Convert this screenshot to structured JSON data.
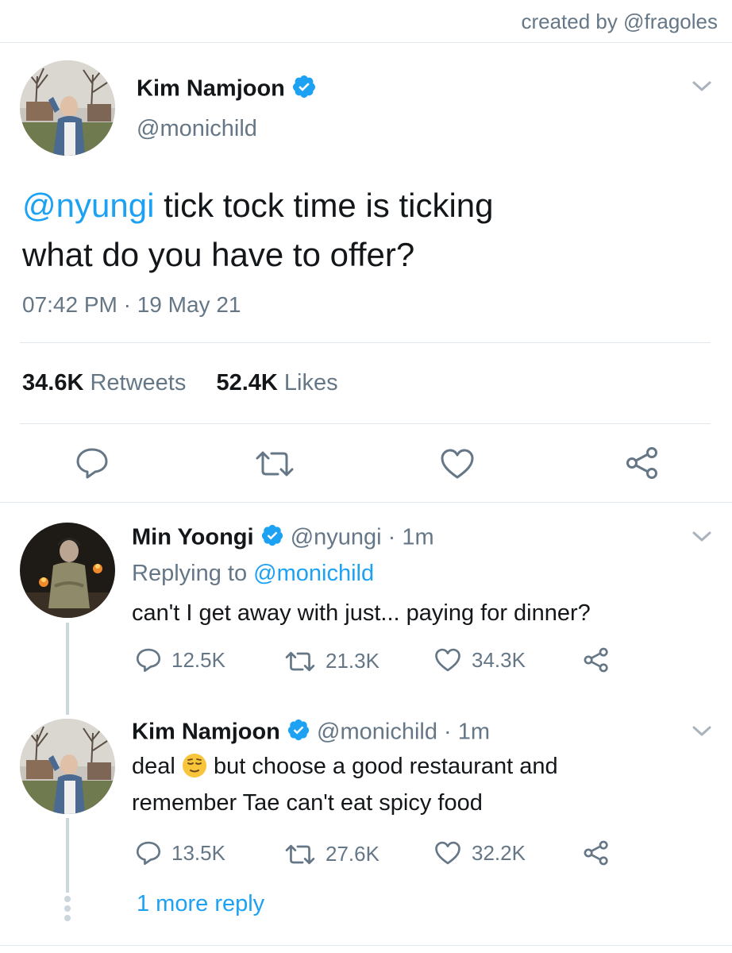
{
  "credit": "created by @fragoles",
  "main_tweet": {
    "name": "Kim Namjoon",
    "handle": "@monichild",
    "mention": "@nyungi",
    "text_line1": " tick tock time is ticking",
    "text_line2": "what do you have to offer?",
    "timestamp": "07:42 PM · 19 May 21",
    "retweets_count": "34.6K",
    "retweets_label": "Retweets",
    "likes_count": "52.4K",
    "likes_label": "Likes",
    "actions": [
      "reply-icon",
      "retweet-icon",
      "like-icon",
      "share-icon"
    ]
  },
  "reply1": {
    "name": "Min Yoongi",
    "handle": "@nyungi",
    "time": "· 1m",
    "replying_prefix": "Replying to ",
    "replying_to": "@monichild",
    "text": "can't I get away with just... paying for dinner?",
    "replies": "12.5K",
    "retweets": "21.3K",
    "likes": "34.3K"
  },
  "reply2": {
    "name": "Kim Namjoon",
    "handle": "@monichild",
    "time": "· 1m",
    "text_before_emoji": "deal ",
    "emoji": "relieved-face-emoji",
    "text_after_emoji": " but choose a good restaurant and",
    "text_line2": "remember Tae can't eat spicy food",
    "replies": "13.5K",
    "retweets": "27.6K",
    "likes": "32.2K"
  },
  "more_replies": "1 more reply",
  "colors": {
    "accent": "#1da1f2",
    "text": "#14171a",
    "secondary": "#657786",
    "divider": "#e1e8ed"
  }
}
